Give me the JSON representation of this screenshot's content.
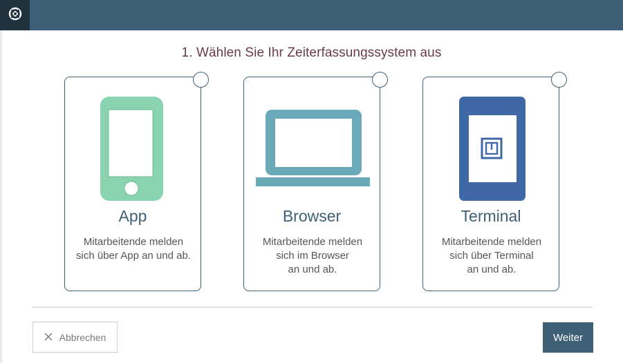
{
  "header": {
    "logo_icon": "lifebuoy-icon",
    "colors": {
      "bar": "#3f5f76",
      "logo_bg": "#21323f"
    }
  },
  "main": {
    "heading": "1. Wählen Sie Ihr Zeiterfassungssystem aus",
    "options": [
      {
        "title": "App",
        "description": "Mitarbeitende melden\nsich über App an und ab.",
        "icon": "smartphone-icon",
        "color": "#8ad3b1"
      },
      {
        "title": "Browser",
        "description": "Mitarbeitende melden\nsich im Browser\nan und ab.",
        "icon": "laptop-icon",
        "color": "#6aaab8"
      },
      {
        "title": "Terminal",
        "description": "Mitarbeitende melden\nsich über  Terminal\nan und ab.",
        "icon": "terminal-device-icon",
        "color": "#4068a6"
      }
    ]
  },
  "footer": {
    "cancel_label": "Abbrechen",
    "cancel_icon": "close-icon",
    "next_label": "Weiter"
  }
}
